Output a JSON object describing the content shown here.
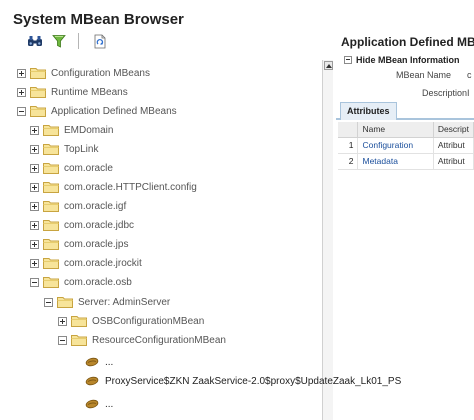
{
  "page": {
    "title": "System MBean Browser"
  },
  "toolbar": {
    "icons": [
      "binoculars-icon",
      "filter-icon",
      "refresh-icon"
    ]
  },
  "tree": {
    "configuration_mbeans": "Configuration MBeans",
    "runtime_mbeans": "Runtime MBeans",
    "application_defined_mbeans": "Application Defined MBeans",
    "emdomain": "EMDomain",
    "toplink": "TopLink",
    "com_oracle": "com.oracle",
    "com_oracle_httpclient_config": "com.oracle.HTTPClient.config",
    "com_oracle_igf": "com.oracle.igf",
    "com_oracle_jdbc": "com.oracle.jdbc",
    "com_oracle_jps": "com.oracle.jps",
    "com_oracle_jrockit": "com.oracle.jrockit",
    "com_oracle_osb": "com.oracle.osb",
    "server_adminserver": "Server: AdminServer",
    "osb_configuration_mbean": "OSBConfigurationMBean",
    "resource_configuration_mbean": "ResourceConfigurationMBean",
    "leaf_1": "...",
    "leaf_2": "ProxyService$ZKN ZaakService-2.0$proxy$UpdateZaak_Lk01_PS",
    "leaf_3": "..."
  },
  "detail": {
    "title": "Application Defined MBea",
    "section_label": "Hide MBean Information",
    "mbean_name_label": "MBean Name",
    "mbean_name_value": "c",
    "description_label": "Description",
    "description_value": "I",
    "tab_attributes": "Attributes",
    "columns": {
      "name": "Name",
      "description": "Descript"
    },
    "rows": [
      {
        "index": "1",
        "name": "Configuration",
        "description": "Attribut"
      },
      {
        "index": "2",
        "name": "Metadata",
        "description": "Attribut"
      }
    ]
  },
  "colors": {
    "folder_fill": "#f7e49a",
    "folder_stroke": "#c8a440",
    "link": "#1b4f9c",
    "tab_border": "#a9c4dc"
  }
}
